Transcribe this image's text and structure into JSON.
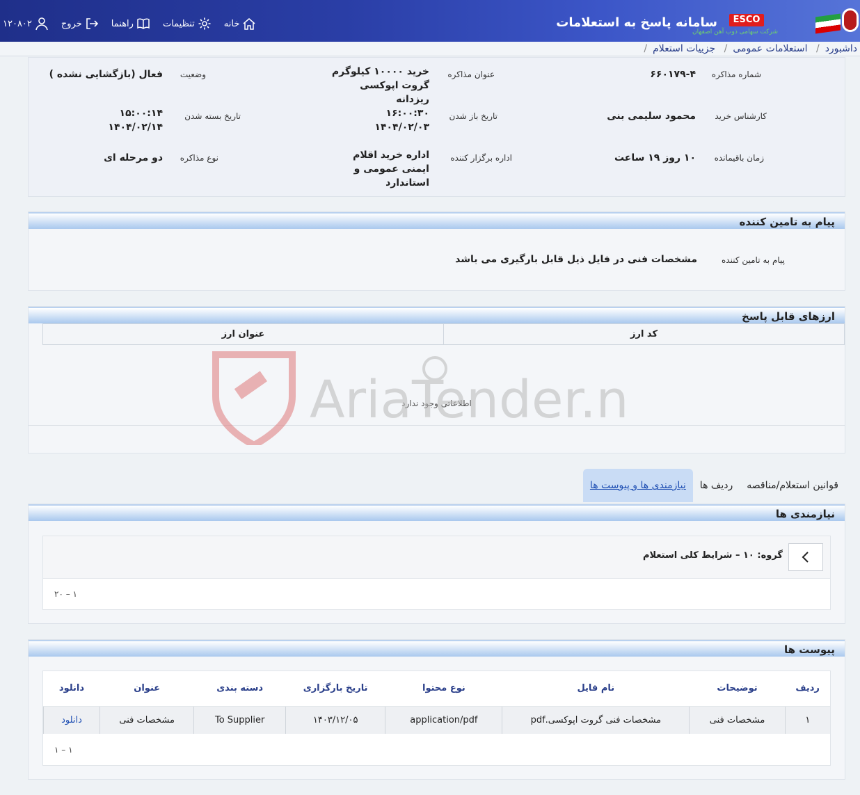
{
  "header": {
    "system_title": "سامانه پاسخ به استعلامات",
    "logo_text": "ESCO",
    "logo_subtitle": "شرکت سهامی ذوب آهن اصفهان",
    "nav": {
      "home": "خانه",
      "settings": "تنظیمات",
      "help": "راهنما",
      "logout": "خروج",
      "user_id": "۱۲۰۸۰۲"
    }
  },
  "breadcrumb": [
    "داشبورد",
    "استعلامات عمومی",
    "جزییات استعلام"
  ],
  "details": {
    "negotiation_number_label": "شماره مذاکره",
    "negotiation_number": "۶۶۰۱۷۹-۴",
    "negotiation_title_label": "عنوان مذاکره",
    "negotiation_title": "خرید ۱۰۰۰۰ کیلوگرم گروت اپوکسی ریزدانه",
    "status_label": "وضعیت",
    "status": "فعال (بازگشایی نشده )",
    "buyer_expert_label": "کارشناس خرید",
    "buyer_expert": "محمود سلیمی بنی",
    "open_date_label": "تاریخ باز شدن",
    "open_time": "۱۶:۰۰:۳۰",
    "open_date": "۱۴۰۴/۰۲/۰۳",
    "close_date_label": "تاریخ بسته شدن",
    "close_time": "۱۵:۰۰:۱۴",
    "close_date": "۱۴۰۴/۰۲/۱۴",
    "remaining_label": "زمان باقیمانده",
    "remaining": "۱۰ روز ۱۹ ساعت",
    "organizer_label": "اداره برگزار کننده",
    "organizer": "اداره خرید اقلام ایمنی عمومی و استاندارد",
    "type_label": "نوع مذاکره",
    "type": "دو مرحله ای"
  },
  "supplier_message": {
    "section_title": "پیام به تامین کننده",
    "label": "پیام به تامین کننده",
    "text": "مشخصات فنی در فایل ذیل قابل بارگیری می باشد"
  },
  "currencies": {
    "section_title": "ارزهای قابل پاسخ",
    "col_code": "کد ارز",
    "col_title": "عنوان ارز",
    "empty_text": "اطلاعاتی وجود ندارد"
  },
  "watermark": "AriaTender.neT",
  "tabs": [
    "نیازمندی ها و پیوست ها",
    "ردیف ها",
    "قوانین استعلام/مناقصه"
  ],
  "requirements": {
    "section_title": "نیازمندی ها",
    "group_text": "گروه: ۱۰ – شرایط کلی استعلام",
    "pagination": "۱ – ۲۰"
  },
  "attachments": {
    "section_title": "پیوست ها",
    "columns": [
      "ردیف",
      "توضیحات",
      "نام فایل",
      "نوع محتوا",
      "تاریخ بارگزاری",
      "دسته بندی",
      "عنوان",
      "دانلود"
    ],
    "rows": [
      [
        "۱",
        "مشخصات فنی",
        "مشخصات فنی گروت اپوکسی.pdf",
        "application/pdf",
        "۱۴۰۳/۱۲/۰۵",
        "To Supplier",
        "مشخصات فنی",
        "دانلود"
      ]
    ],
    "pagination": "۱ – ۱"
  },
  "colors": {
    "header_bg": "#2a3ea6",
    "panel_header": "#a9c8ee",
    "link": "#1f4fb3"
  }
}
